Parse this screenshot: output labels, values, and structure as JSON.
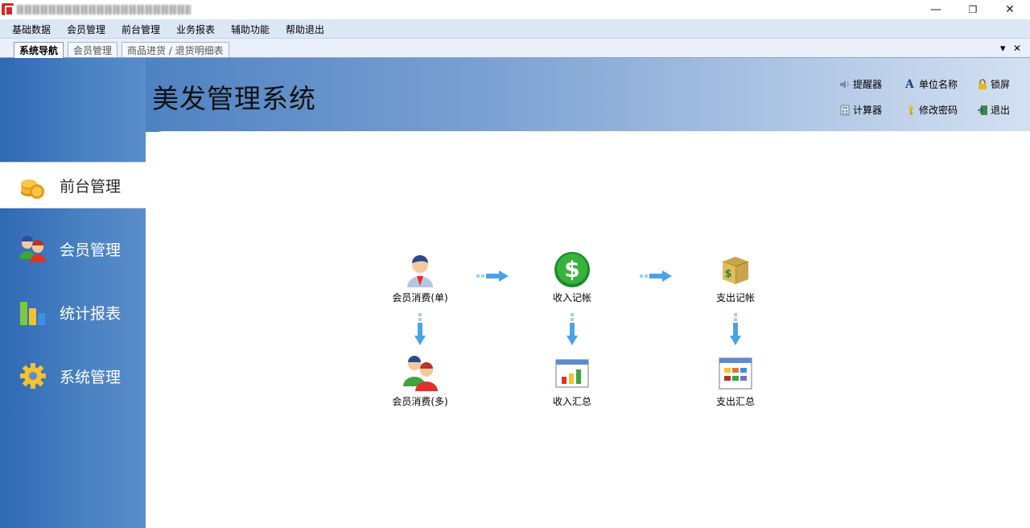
{
  "window": {
    "minimize_glyph": "—",
    "restore_glyph": "❐",
    "close_glyph": "✕"
  },
  "menu": [
    "基础数据",
    "会员管理",
    "前台管理",
    "业务报表",
    "辅助功能",
    "帮助退出"
  ],
  "tabs": [
    "系统导航",
    "会员管理",
    "商品进货 / 退货明细表"
  ],
  "tab_controls": {
    "dropdown": "▾",
    "close": "✕"
  },
  "header": {
    "title": "美发管理系统",
    "tools": [
      {
        "label": "提醒器",
        "icon": "speaker-icon"
      },
      {
        "label": "单位名称",
        "icon": "font-a-icon"
      },
      {
        "label": "锁屏",
        "icon": "lock-icon"
      },
      {
        "label": "计算器",
        "icon": "calculator-icon"
      },
      {
        "label": "修改密码",
        "icon": "key-icon"
      },
      {
        "label": "退出",
        "icon": "exit-door-icon"
      }
    ]
  },
  "sidebar": {
    "items": [
      {
        "label": "前台管理",
        "icon": "coins-icon",
        "active": true
      },
      {
        "label": "会员管理",
        "icon": "users-icon",
        "active": false
      },
      {
        "label": "统计报表",
        "icon": "bar-chart-icon",
        "active": false
      },
      {
        "label": "系统管理",
        "icon": "gear-icon",
        "active": false
      }
    ]
  },
  "flow": {
    "nodes": [
      {
        "label": "会员消费(单)",
        "icon": "member-icon"
      },
      {
        "label": "收入记帐",
        "icon": "dollar-icon"
      },
      {
        "label": "支出记帐",
        "icon": "money-box-icon"
      },
      {
        "label": "会员消费(多)",
        "icon": "members-icon"
      },
      {
        "label": "收入汇总",
        "icon": "income-summary-icon"
      },
      {
        "label": "支出汇总",
        "icon": "expense-summary-icon"
      }
    ]
  },
  "colors": {
    "panel_blue": "#2f69b3",
    "menu_bg": "#dce7f6",
    "arrow_blue": "#4aa3e8"
  }
}
